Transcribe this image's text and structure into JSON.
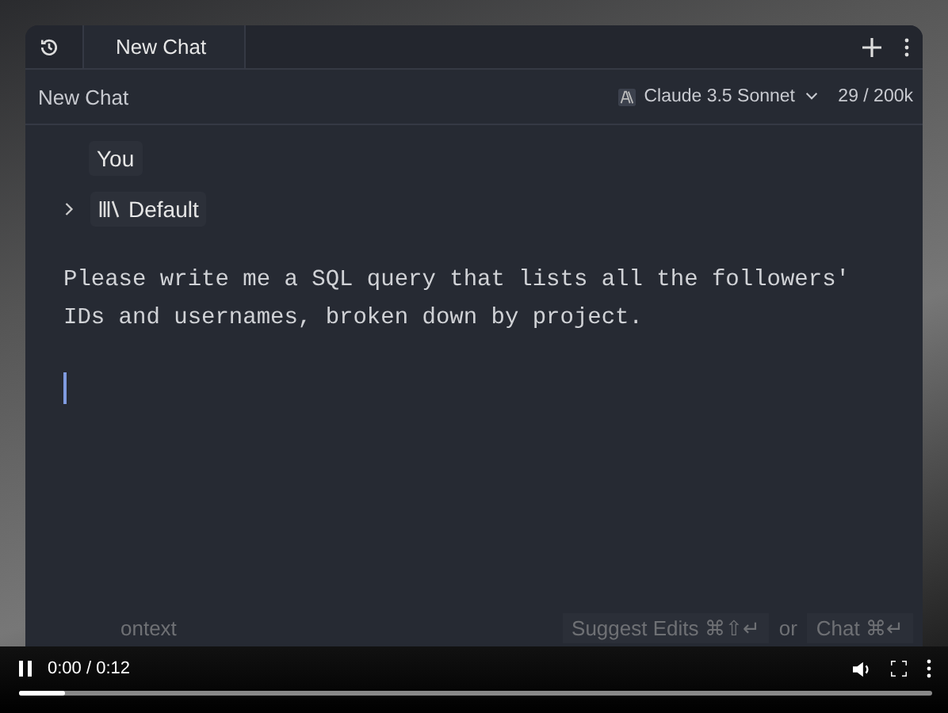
{
  "tabs": [
    {
      "label": "New Chat",
      "selected": true
    }
  ],
  "header": {
    "title": "New Chat",
    "model": "Claude 3.5 Sonnet",
    "tokens": "29 / 200k"
  },
  "message": {
    "author": "You",
    "context": "Default",
    "context_expanded": false,
    "text": "Please write me a SQL query that lists all the followers' IDs and usernames, broken down by project."
  },
  "footer": {
    "context": "ontext",
    "suggest": "Suggest Edits ⌘⇧↵",
    "or": "or",
    "chat": "Chat ⌘↵"
  },
  "player": {
    "playing": true,
    "time": "0:00 / 0:12",
    "level": 0.05
  }
}
